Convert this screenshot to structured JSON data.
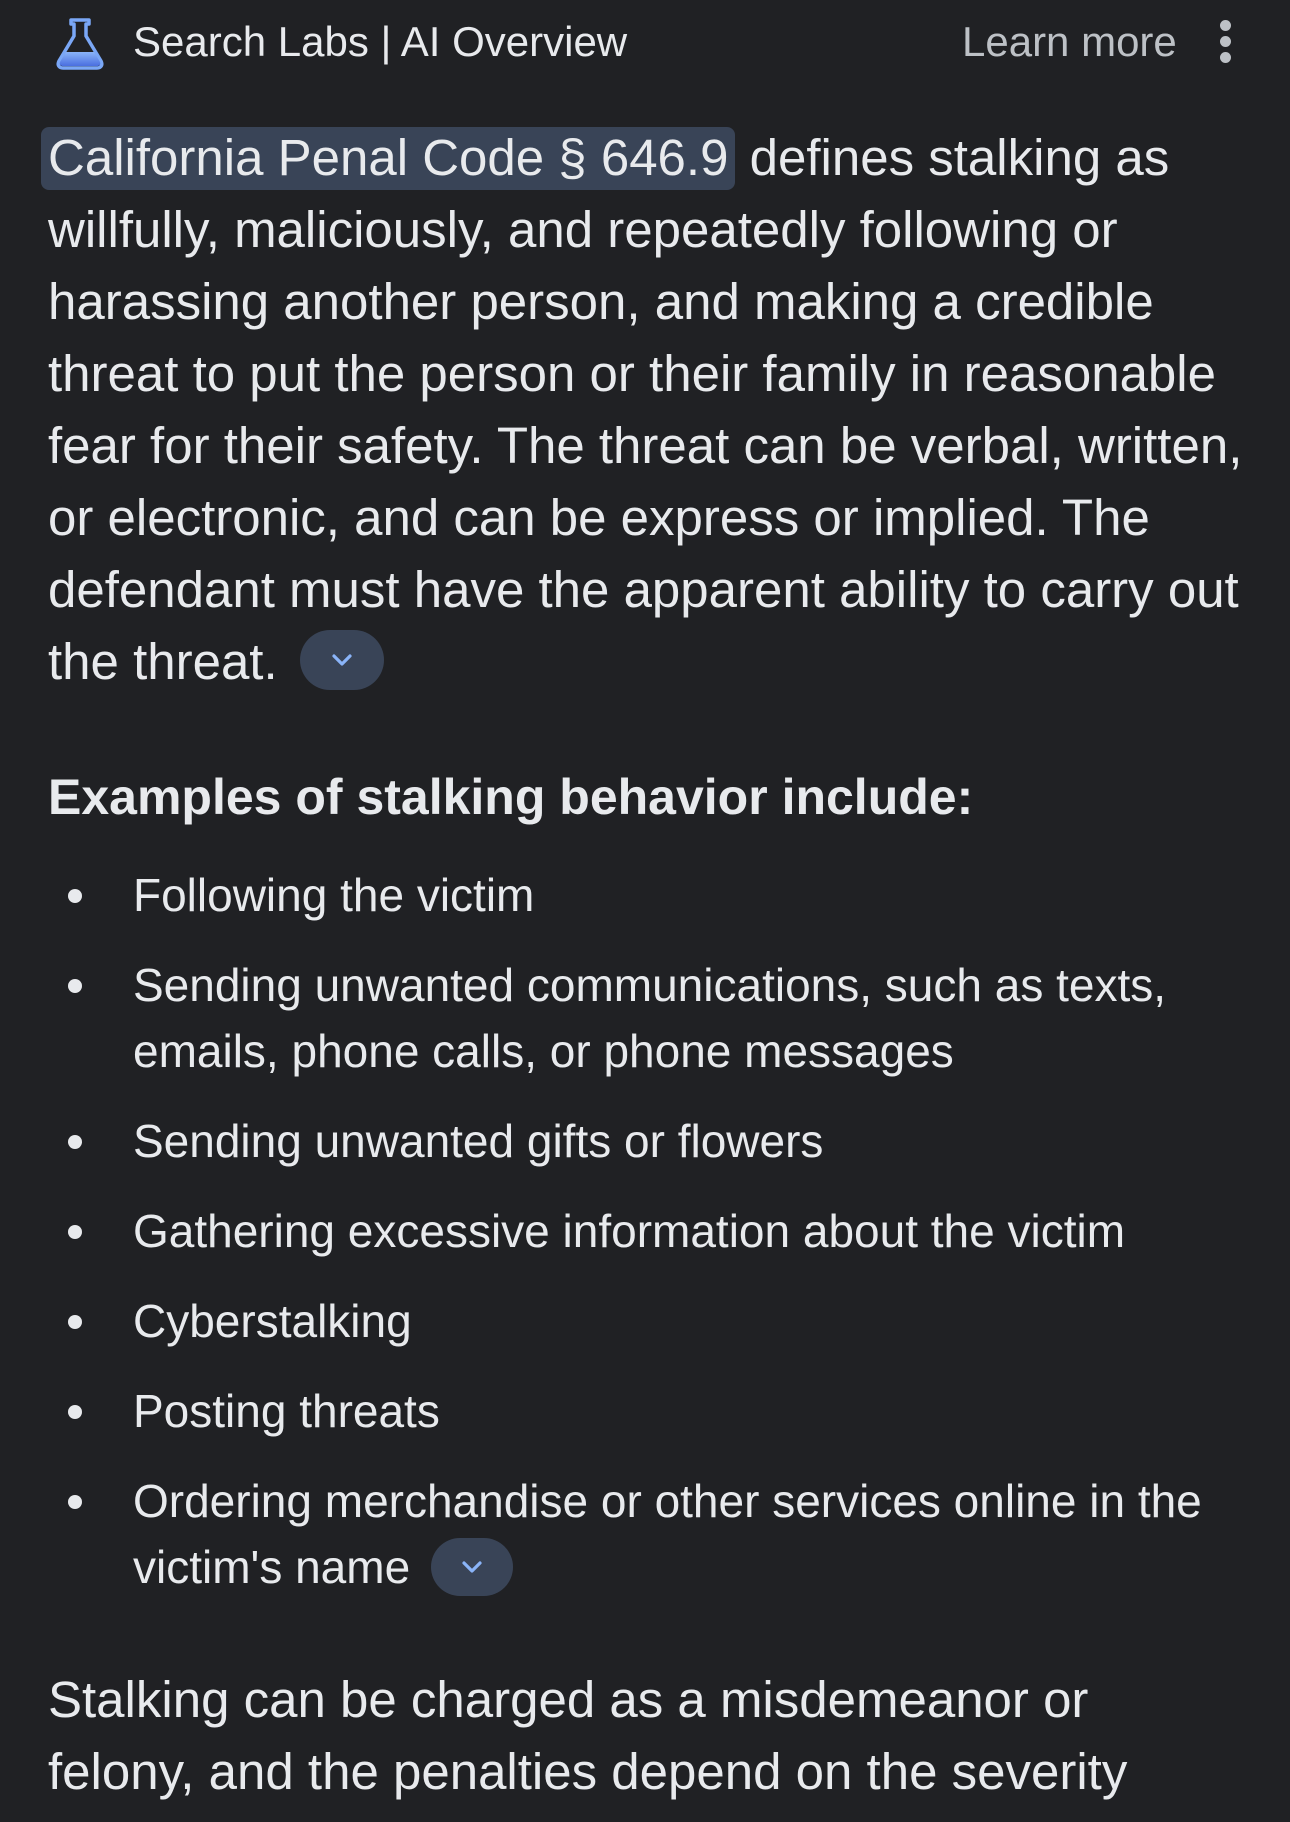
{
  "header": {
    "title": "Search Labs | AI Overview",
    "learn_more": "Learn more",
    "icon": "flask-icon",
    "menu_icon": "more-vert-icon"
  },
  "overview": {
    "citation": "California Penal Code § 646.9",
    "text": " defines stalking as willfully, maliciously, and repeatedly following or harassing another person, and making a credible threat to put the person or their family in reasonable fear for their safety. The threat can be verbal, written, or electronic, and can be express or implied. The defendant must have the apparent ability to carry out the threat. ",
    "expand_icon": "chevron-down-icon"
  },
  "examples": {
    "heading": "Examples of stalking behavior include:",
    "items": [
      "Following the victim",
      "Sending unwanted communications, such as texts, emails, phone calls, or phone messages",
      "Sending unwanted gifts or flowers",
      "Gathering excessive information about the victim",
      "Cyberstalking",
      "Posting threats",
      "Ordering merchandise or other services online in the victim's name"
    ]
  },
  "closing": {
    "text": "Stalking can be charged as a misdemeanor or felony, and the penalties depend on the severity"
  },
  "colors": {
    "background": "#202124",
    "text": "#e8eaed",
    "muted": "#bdc1c6",
    "chip": "#394457",
    "accent": "#7aa7f6"
  }
}
